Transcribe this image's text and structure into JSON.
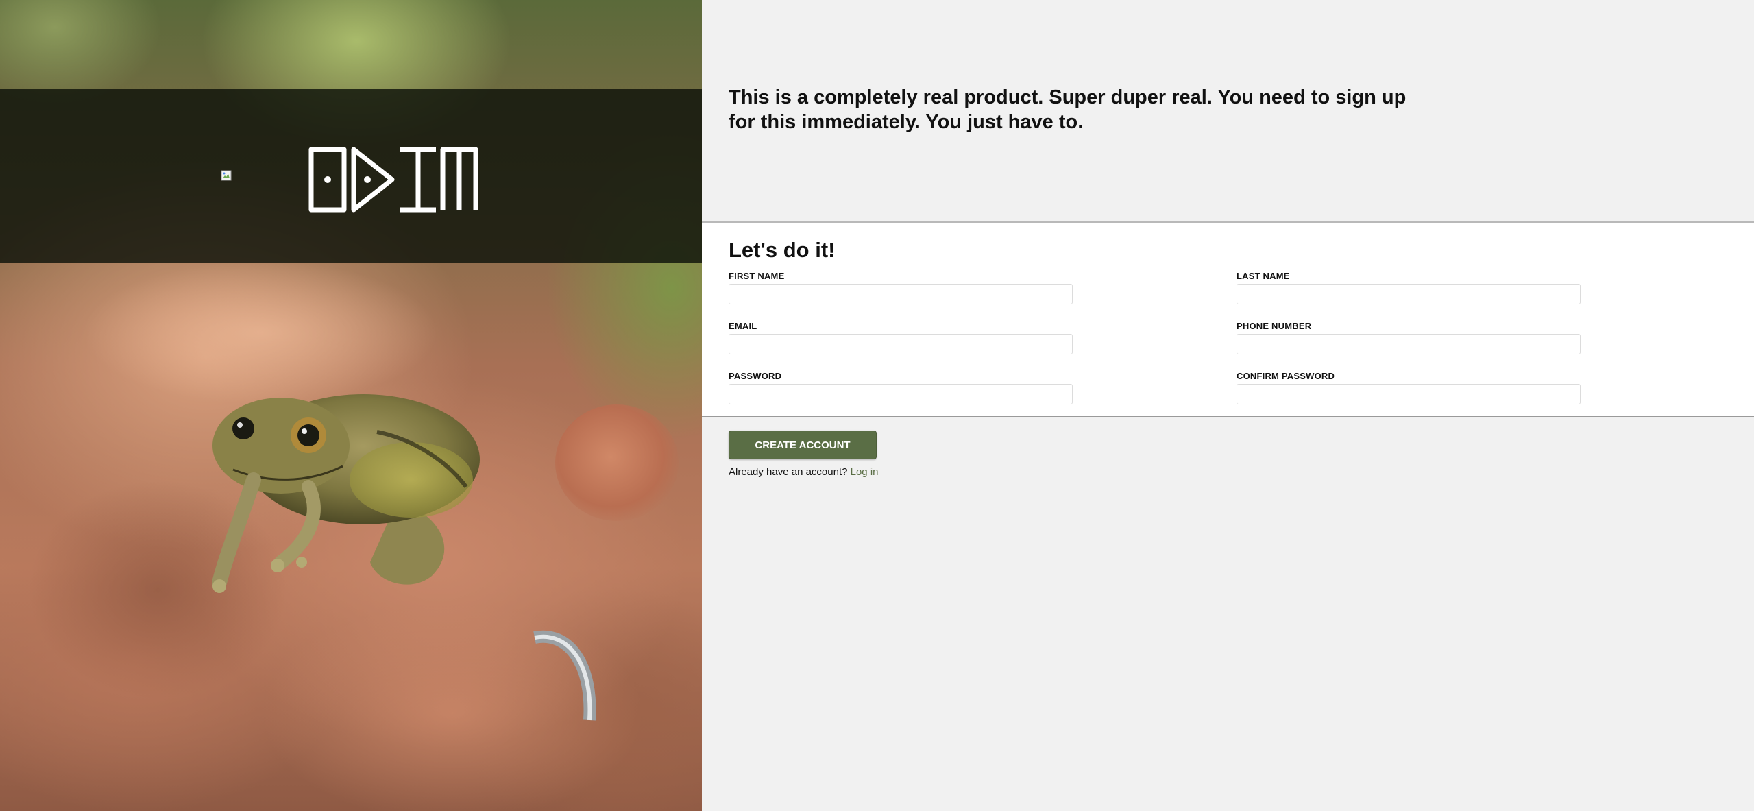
{
  "hero": {
    "text": "This is a completely real product. Super duper real. You need to sign up for this immediately. You just have to."
  },
  "form": {
    "title": "Let's do it!",
    "fields": [
      {
        "label": "FIRST NAME",
        "value": ""
      },
      {
        "label": "LAST NAME",
        "value": ""
      },
      {
        "label": "EMAIL",
        "value": ""
      },
      {
        "label": "PHONE NUMBER",
        "value": ""
      },
      {
        "label": "PASSWORD",
        "value": ""
      },
      {
        "label": "CONFIRM PASSWORD",
        "value": ""
      }
    ],
    "submit_label": "CREATE ACCOUNT",
    "login_prompt": "Already have an account?",
    "login_link": "Log in"
  },
  "colors": {
    "accent": "#5a6e45",
    "panel_bg": "#f1f1f1",
    "form_bg": "#ffffff",
    "banner_bg": "#0e120a"
  },
  "icons": {
    "broken_image": "broken-image-icon",
    "logo": "odin-logo"
  }
}
